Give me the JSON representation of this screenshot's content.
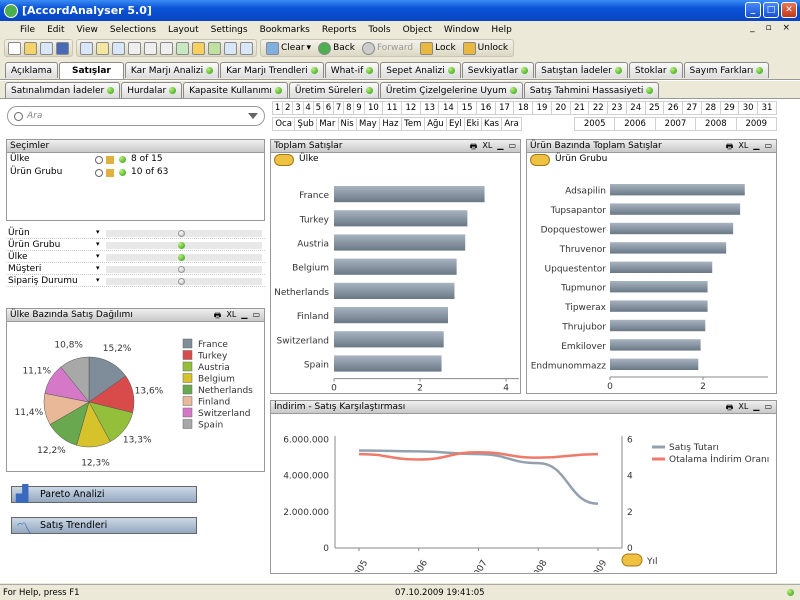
{
  "window": {
    "title": "[AccordAnalyser 5.0]"
  },
  "menu": [
    "File",
    "Edit",
    "View",
    "Selections",
    "Layout",
    "Settings",
    "Bookmarks",
    "Reports",
    "Tools",
    "Object",
    "Window",
    "Help"
  ],
  "menu_right": "_ ▫ ×",
  "toolbar": {
    "clear": "Clear",
    "back": "Back",
    "forward": "Forward",
    "lock": "Lock",
    "unlock": "Unlock"
  },
  "tabs_row1": [
    "Açıklama",
    "Satışlar",
    "Kar Marjı Analizi",
    "Kar Marjı Trendleri",
    "What-if",
    "Sepet Analizi",
    "Sevkiyatlar",
    "Satıştan İadeler",
    "Stoklar",
    "Sayım Farkları"
  ],
  "tabs_row2": [
    "Satınalımdan İadeler",
    "Hurdalar",
    "Kapasite Kullanımı",
    "Üretim Süreleri",
    "Üretim Çizelgelerine Uyum",
    "Satış Tahmini Hassasiyeti"
  ],
  "search": {
    "placeholder": "Ara"
  },
  "days": [
    "1",
    "2",
    "3",
    "4",
    "5",
    "6",
    "7",
    "8",
    "9",
    "10",
    "11",
    "12",
    "13",
    "14",
    "15",
    "16",
    "17",
    "18",
    "19",
    "20",
    "21",
    "22",
    "23",
    "24",
    "25",
    "26",
    "27",
    "28",
    "29",
    "30",
    "31"
  ],
  "months": [
    "Oca",
    "Şub",
    "Mar",
    "Nis",
    "May",
    "Haz",
    "Tem",
    "Ağu",
    "Eyl",
    "Eki",
    "Kas",
    "Ara"
  ],
  "years": [
    "2005",
    "2006",
    "2007",
    "2008",
    "2009"
  ],
  "selections": {
    "title": "Seçimler",
    "rows": [
      {
        "field": "Ülke",
        "value": "8 of 15"
      },
      {
        "field": "Ürün Grubu",
        "value": "10 of 63"
      }
    ]
  },
  "listboxes": [
    "Ürün",
    "Ürün Grubu",
    "Ülke",
    "Müşteri",
    "Sipariş Durumu"
  ],
  "panel_pie": {
    "title": "Ülke Bazında Satış Dağılımı",
    "xl": "XL"
  },
  "panel_toplam": {
    "title": "Toplam Satışlar",
    "dim": "Ülke",
    "unit": "1.000.000 €",
    "xl": "XL"
  },
  "panel_urun": {
    "title": "Ürün Bazında Toplam Satışlar",
    "dim": "Ürün Grubu",
    "unit": "1.000.000 €",
    "xl": "XL"
  },
  "panel_indirim": {
    "title": "İndirim - Satış Karşılaştırması",
    "dim": "Yıl",
    "xl": "XL"
  },
  "buttons": {
    "pareto": "Pareto Analizi",
    "trend": "Satış Trendleri"
  },
  "status": {
    "help": "For Help, press F1",
    "datetime": "07.10.2009 19:41:05"
  },
  "colors": {
    "bar": "#7f8c99",
    "tab_active": "#ffffff",
    "title_blue": "#0a52d6"
  },
  "chart_data": [
    {
      "type": "pie",
      "categories": [
        "France",
        "Turkey",
        "Austria",
        "Belgium",
        "Netherlands",
        "Finland",
        "Switzerland",
        "Spain"
      ],
      "values": [
        15.2,
        13.6,
        13.3,
        12.3,
        12.2,
        11.4,
        11.1,
        10.8
      ],
      "labels": [
        "15,2%",
        "13,6%",
        "13,3%",
        "12,3%",
        "12,2%",
        "11,4%",
        "11,1%",
        "10,8%"
      ],
      "colors": [
        "#7f8c99",
        "#d94b4b",
        "#93bf3b",
        "#d6c22b",
        "#6aa84f",
        "#e8b898",
        "#d678c8",
        "#a8a8a8"
      ],
      "legend": "right"
    },
    {
      "type": "bar",
      "orientation": "horizontal",
      "categories": [
        "France",
        "Turkey",
        "Austria",
        "Belgium",
        "Netherlands",
        "Finland",
        "Switzerland",
        "Spain"
      ],
      "values": [
        3.5,
        3.1,
        3.05,
        2.85,
        2.8,
        2.65,
        2.55,
        2.5
      ],
      "xticks": [
        "0",
        "2",
        "4"
      ],
      "xlim": [
        0,
        4.3
      ],
      "xlabel": "1.000.000 €"
    },
    {
      "type": "bar",
      "orientation": "horizontal",
      "categories": [
        "Adsapilin",
        "Tupsapantor",
        "Dopquestower",
        "Thruvenor",
        "Upquestentor",
        "Tupmunor",
        "Tipwerax",
        "Thrujubor",
        "Emkilover",
        "Endmunommazz"
      ],
      "values": [
        2.9,
        2.8,
        2.65,
        2.5,
        2.2,
        2.1,
        2.1,
        2.05,
        1.95,
        1.9
      ],
      "xticks": [
        "0",
        "2"
      ],
      "xlim": [
        0,
        3.4
      ],
      "xlabel": "1.000.000 €"
    },
    {
      "type": "line",
      "x": [
        "2005",
        "2006",
        "2007",
        "2008",
        "2009"
      ],
      "yticks_left": [
        "0",
        "2.000.000",
        "4.000.000",
        "6.000.000"
      ],
      "yticks_right": [
        "0",
        "2",
        "4",
        "6"
      ],
      "series": [
        {
          "name": "Satış Tutarı",
          "axis": "left",
          "values": [
            5400000,
            5350000,
            5200000,
            4700000,
            2450000
          ],
          "color": "#93a0ad"
        },
        {
          "name": "Otalama İndirim Oranı",
          "axis": "right",
          "values": [
            5.2,
            4.9,
            5.3,
            5.0,
            5.2
          ],
          "color": "#f07a6a"
        }
      ],
      "ylim_left": [
        0,
        6200000
      ],
      "ylim_right": [
        0,
        6.2
      ],
      "xlabel": "Yıl",
      "legend": "top-right"
    }
  ]
}
